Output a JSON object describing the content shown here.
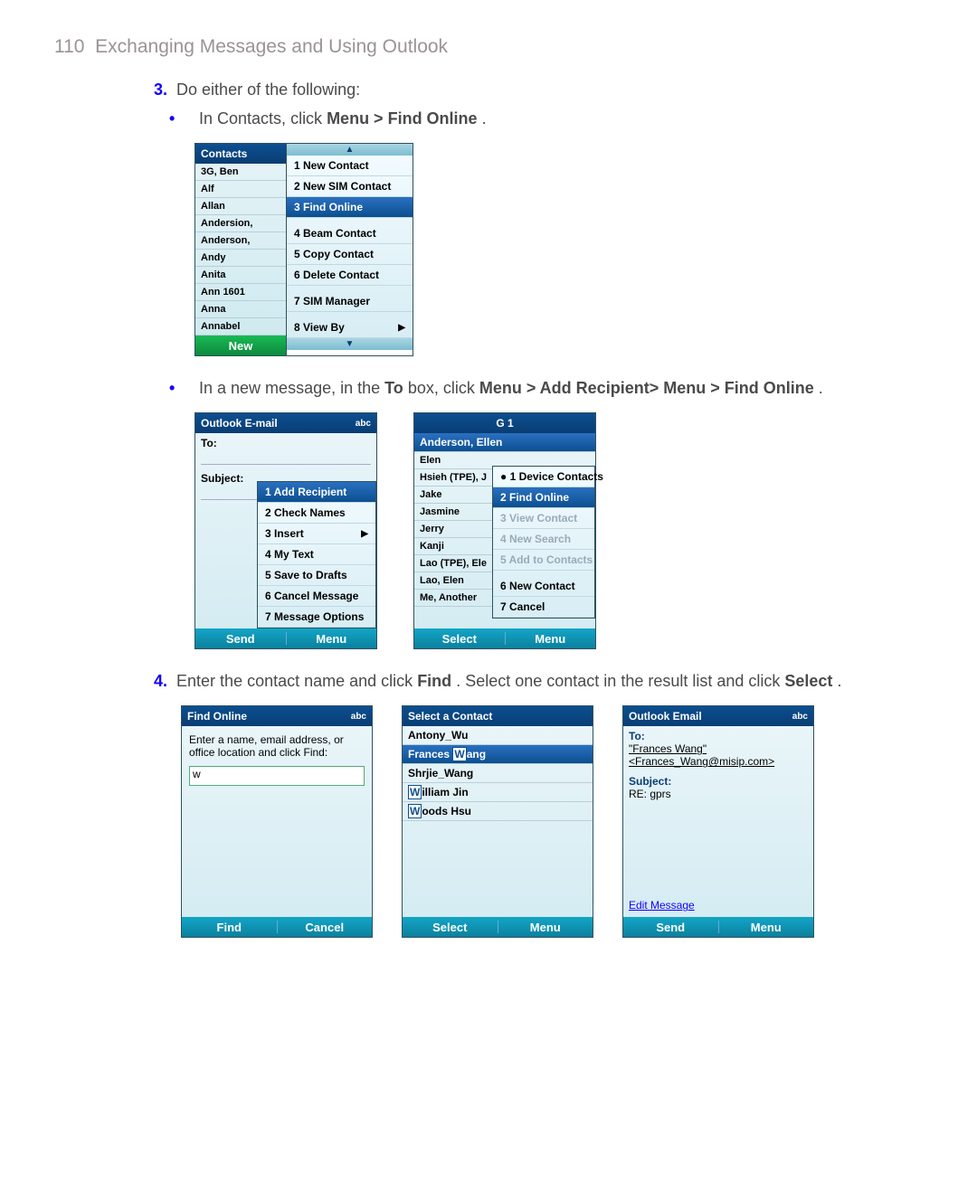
{
  "page": {
    "number": "110",
    "title": "Exchanging Messages and Using Outlook"
  },
  "step3": {
    "num": "3.",
    "text": "Do either of the following:",
    "bullet1_pre": "In Contacts, click ",
    "bullet1_bold": "Menu > Find Online",
    "bullet1_post": ".",
    "bullet2_pre": "In a new message, in the ",
    "bullet2_b1": "To",
    "bullet2_mid": " box, click ",
    "bullet2_b2": "Menu > Add Recipient> Menu > Find Online",
    "bullet2_post": "."
  },
  "step4": {
    "num": "4.",
    "text_pre": "Enter the contact name and click ",
    "text_b1": "Find",
    "text_mid": ". Select one contact in the result list and click ",
    "text_b2": "Select",
    "text_post": "."
  },
  "fig_contacts": {
    "title": "Contacts",
    "rows": [
      "3G, Ben",
      "Alf",
      "Allan",
      "Andersion,",
      "Anderson,",
      "Andy",
      "Anita",
      "Ann 1601",
      "Anna",
      "Annabel"
    ],
    "menu": [
      {
        "t": "1 New Contact"
      },
      {
        "t": "2 New SIM Contact"
      },
      {
        "t": "3 Find Online",
        "sel": true
      },
      {
        "t": "4 Beam Contact",
        "gap": true
      },
      {
        "t": "5 Copy Contact"
      },
      {
        "t": "6 Delete Contact"
      },
      {
        "t": "7 SIM Manager",
        "gap": true
      },
      {
        "t": "8 View By",
        "sub": true,
        "gap": true
      }
    ],
    "sk_left": "New"
  },
  "fig_newmsg": {
    "title": "Outlook E-mail",
    "to_lbl": "To:",
    "subj_lbl": "Subject:",
    "menu": [
      {
        "t": "1 Add Recipient",
        "sel": true
      },
      {
        "t": "2 Check Names"
      },
      {
        "t": "3 Insert",
        "sub": true
      },
      {
        "t": "4 My Text"
      },
      {
        "t": "5 Save to Drafts"
      },
      {
        "t": "6 Cancel Message"
      },
      {
        "t": "7 Message Options"
      }
    ],
    "sk_left": "Send",
    "sk_right": "Menu",
    "ind": "abc"
  },
  "fig_company": {
    "title": "G 1",
    "sel_row": "Anderson, Ellen",
    "rows": [
      "Elen",
      "Hsieh (TPE), J",
      "Jake",
      "Jasmine",
      "Jerry",
      "Kanji",
      "Lao (TPE), Ele",
      "Lao, Elen",
      "Me, Another"
    ],
    "menu": [
      {
        "t": "● 1 Device Contacts"
      },
      {
        "t": "2 Find Online",
        "sel": true
      },
      {
        "t": "3 View Contact",
        "dis": true
      },
      {
        "t": "4 New Search",
        "dis": true
      },
      {
        "t": "5 Add to Contacts",
        "dis": true
      },
      {
        "t": "6 New Contact",
        "gap": true
      },
      {
        "t": "7 Cancel"
      }
    ],
    "sk_left": "Select",
    "sk_right": "Menu"
  },
  "fig_find": {
    "title": "Find Online",
    "hint": "Enter a name, email address, or office location and click Find:",
    "value": "w",
    "sk_left": "Find",
    "sk_right": "Cancel",
    "ind": "abc"
  },
  "fig_select": {
    "title": "Select a Contact",
    "rows": [
      {
        "t": "Antony_Wu"
      },
      {
        "t": "Frances Wang",
        "sel": true,
        "boxChar": "W",
        "rest": "ang",
        "pre": "Frances "
      },
      {
        "t": "Shrjie_Wang"
      },
      {
        "t": "William Jin",
        "boxChar": "W",
        "rest": "illiam Jin"
      },
      {
        "t": "Woods Hsu",
        "boxChar": "W",
        "rest": "oods Hsu"
      }
    ],
    "sk_left": "Select",
    "sk_right": "Menu"
  },
  "fig_result": {
    "title": "Outlook Email",
    "to_lbl": "To:",
    "to_name": "\"Frances Wang\"",
    "to_addr": "<Frances_Wang@misip.com>",
    "subj_lbl": "Subject:",
    "subj_val": "RE: gprs",
    "edit": "Edit Message",
    "sk_left": "Send",
    "sk_right": "Menu",
    "ind": "abc"
  }
}
